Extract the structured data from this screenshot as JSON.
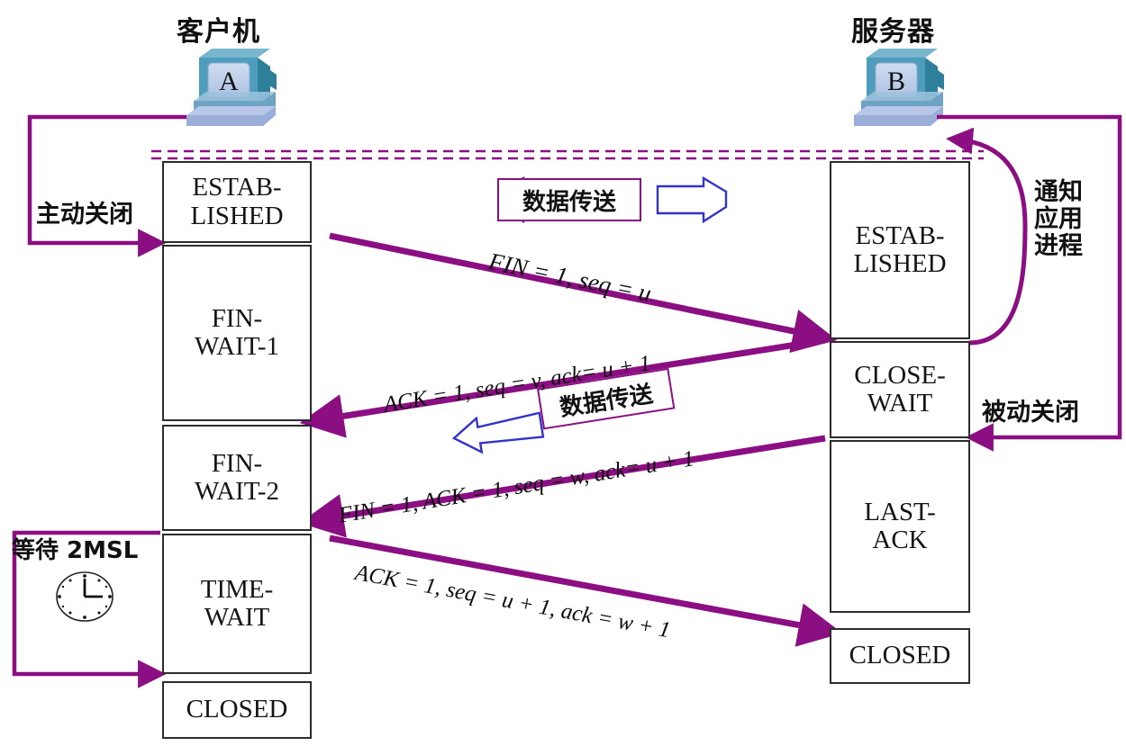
{
  "headers": {
    "client": "客户机",
    "server": "服务器"
  },
  "hosts": {
    "client_label": "A",
    "server_label": "B"
  },
  "colors": {
    "purple": "#8B0F82",
    "blue_arrow": "#3333CC",
    "box_border": "#2c2c2c",
    "monitor_dark": "#3E8FA8",
    "monitor_mid": "#7FA6D0",
    "monitor_light": "#BFCFEA"
  },
  "client_states": [
    {
      "lines": [
        "ESTAB-",
        "LISHED"
      ]
    },
    {
      "lines": [
        "FIN-",
        "WAIT-1"
      ]
    },
    {
      "lines": [
        "FIN-",
        "WAIT-2"
      ]
    },
    {
      "lines": [
        "TIME-",
        "WAIT"
      ]
    },
    {
      "lines": [
        "CLOSED"
      ]
    }
  ],
  "server_states": [
    {
      "lines": [
        "ESTAB-",
        "LISHED"
      ]
    },
    {
      "lines": [
        "CLOSE-",
        "WAIT"
      ]
    },
    {
      "lines": [
        "LAST-",
        "ACK"
      ]
    },
    {
      "lines": [
        "CLOSED"
      ]
    }
  ],
  "annotations": {
    "active_close": "主动关闭",
    "passive_close": "被动关闭",
    "notify_app": "通知\n应用\n进程",
    "notify_app_lines": [
      "通知",
      "应用",
      "进程"
    ],
    "wait_2msl": "等待 2MSL",
    "data_transfer_1": "数据传送",
    "data_transfer_2": "数据传送"
  },
  "messages": [
    {
      "id": "fin-u",
      "text": "FIN = 1, seq = u"
    },
    {
      "id": "ack-v",
      "text": "ACK = 1, seq = v, ack= u + 1"
    },
    {
      "id": "fin-ack-w",
      "text": "FIN = 1, ACK = 1, seq = w, ack= u + 1"
    },
    {
      "id": "ack-u1",
      "text": "ACK = 1, seq = u + 1, ack = w + 1"
    }
  ],
  "icons": {
    "clock": "clock-icon",
    "client_computer": "computer-icon",
    "server_computer": "computer-icon"
  }
}
